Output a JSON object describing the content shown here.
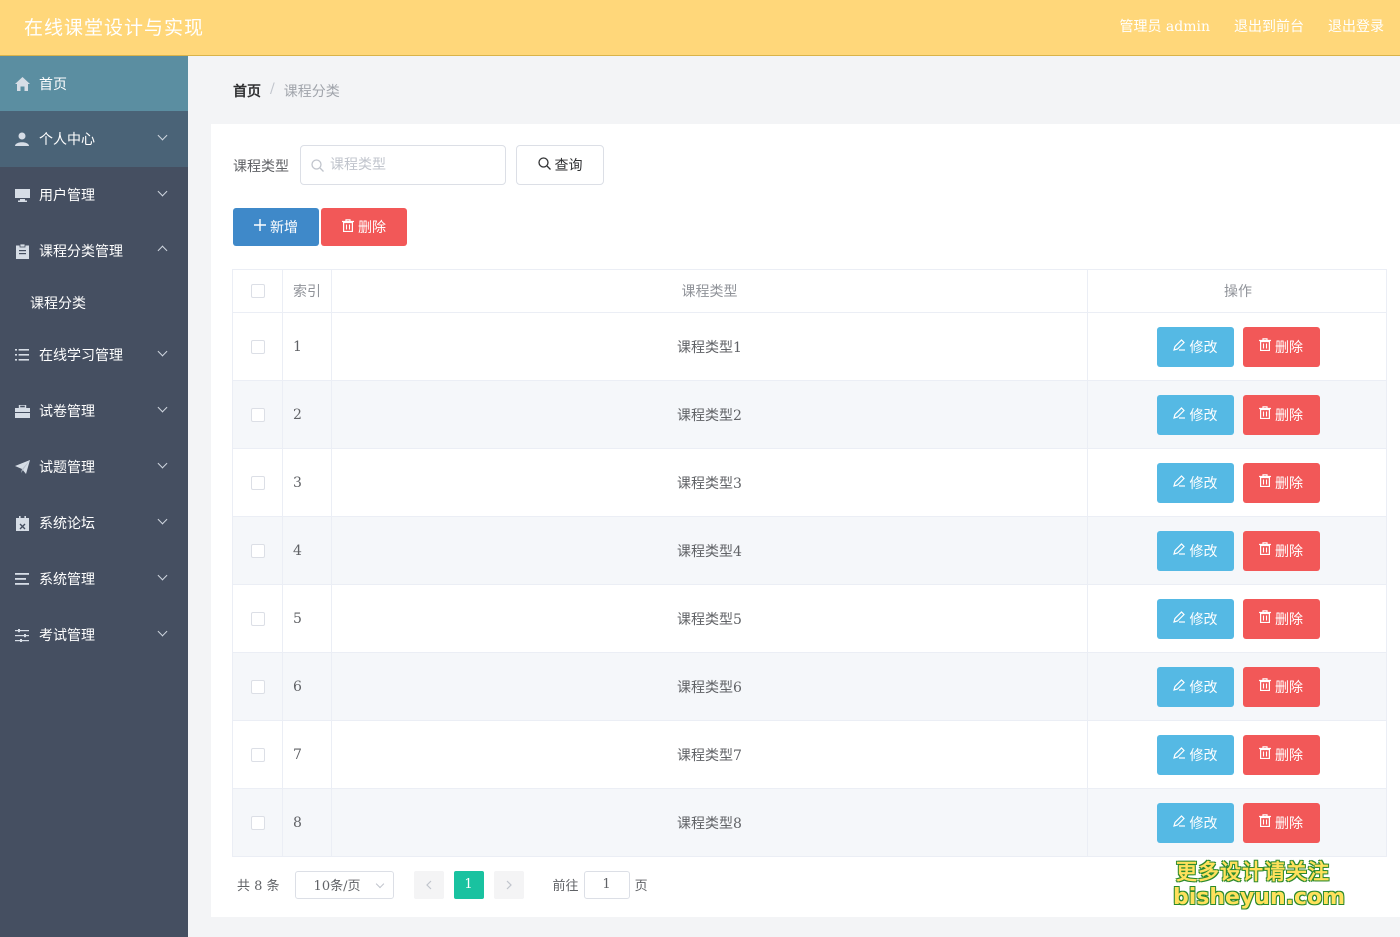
{
  "header": {
    "title": "在线课堂设计与实现",
    "admin_label": "管理员 admin",
    "front_link": "退出到前台",
    "logout_link": "退出登录",
    "bg_color": "#ffd77a"
  },
  "sidebar": {
    "items": [
      {
        "label": "首页",
        "icon": "home-icon"
      },
      {
        "label": "个人中心",
        "icon": "user-icon"
      },
      {
        "label": "用户管理",
        "icon": "monitor-icon"
      },
      {
        "label": "课程分类管理",
        "icon": "clipboard-icon"
      },
      {
        "label": "课程分类"
      },
      {
        "label": "在线学习管理",
        "icon": "list-icon"
      },
      {
        "label": "试卷管理",
        "icon": "briefcase-icon"
      },
      {
        "label": "试题管理",
        "icon": "send-icon"
      },
      {
        "label": "系统论坛",
        "icon": "calendar-icon"
      },
      {
        "label": "系统管理",
        "icon": "menu-icon"
      },
      {
        "label": "考试管理",
        "icon": "sliders-icon"
      }
    ]
  },
  "breadcrumb": {
    "home": "首页",
    "separator": "/",
    "current": "课程分类"
  },
  "search": {
    "label": "课程类型",
    "placeholder": "课程类型",
    "query_button": "查询"
  },
  "actions": {
    "add": "新增",
    "delete": "删除"
  },
  "table": {
    "columns": [
      "索引",
      "课程类型",
      "操作"
    ],
    "rows": [
      {
        "index": "1",
        "type": "课程类型1"
      },
      {
        "index": "2",
        "type": "课程类型2"
      },
      {
        "index": "3",
        "type": "课程类型3"
      },
      {
        "index": "4",
        "type": "课程类型4"
      },
      {
        "index": "5",
        "type": "课程类型5"
      },
      {
        "index": "6",
        "type": "课程类型6"
      },
      {
        "index": "7",
        "type": "课程类型7"
      },
      {
        "index": "8",
        "type": "课程类型8"
      }
    ],
    "edit_label": "修改",
    "delete_label": "删除"
  },
  "pagination": {
    "total": "共 8 条",
    "page_size": "10条/页",
    "current_page": "1",
    "goto_label": "前往",
    "goto_value": "1",
    "page_unit": "页"
  },
  "watermark": {
    "line1": "更多设计请关注",
    "line2": "bisheyun.com"
  },
  "colors": {
    "primary": "#3f89c9",
    "danger": "#f25858",
    "info": "#55b9e4",
    "active_page": "#19c2a0",
    "sidebar": "#454f61"
  }
}
